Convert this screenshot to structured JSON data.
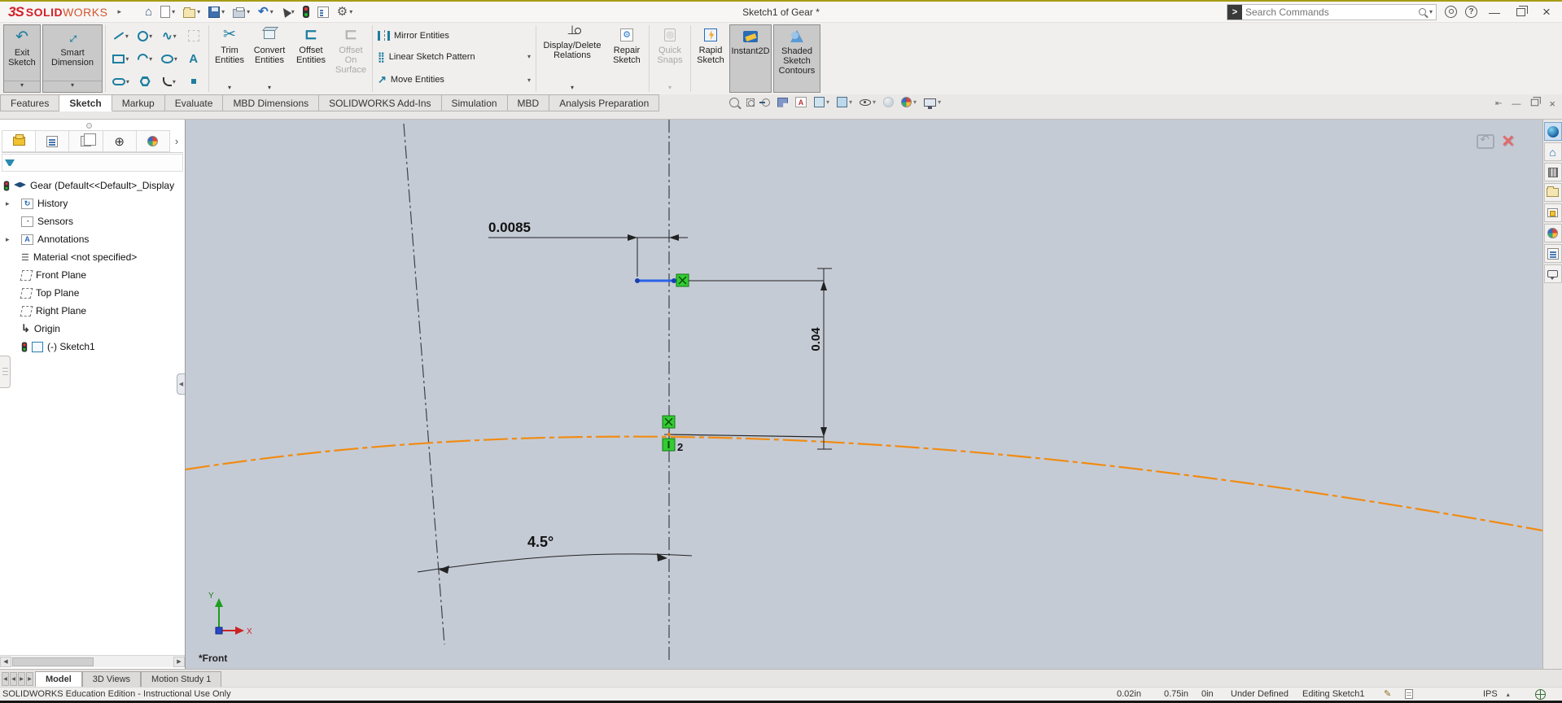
{
  "app": {
    "brand_mark": "3S",
    "brand_bold": "SOLID",
    "brand_light": "WORKS",
    "title": "Sketch1 of Gear *"
  },
  "search_placeholder": "Search Commands",
  "icons": {
    "caret": "▾",
    "caret_up": "▴",
    "expander": "▸",
    "more": "›",
    "home": "⌂",
    "undo": "↶",
    "gear": "⚙",
    "help": "?",
    "minimize": "—",
    "close": "×",
    "left": "◀",
    "right": "▶",
    "history": "↻",
    "gauge": "◔",
    "letter_a": "A",
    "material": "☰",
    "origin": "↳",
    "dimxpert": "⊕",
    "scissors": "✂",
    "offset": "⊏",
    "arrow_ne": "↗",
    "relation": "⊥",
    "pattern": "⣿",
    "snaps": "◎",
    "spline": "∿",
    "pencil": "✎",
    "search_mark": ">"
  },
  "ribbon": {
    "exit_sketch": "Exit Sketch",
    "smart_dimension": "Smart Dimension",
    "trim": "Trim Entities",
    "convert": "Convert Entities",
    "offset": "Offset Entities",
    "offset_on_surface": "Offset On Surface",
    "mirror": "Mirror Entities",
    "linear_pattern": "Linear Sketch Pattern",
    "move": "Move Entities",
    "display_delete": "Display/Delete Relations",
    "repair": "Repair Sketch",
    "quick_snaps": "Quick Snaps",
    "rapid": "Rapid Sketch",
    "instant2d": "Instant2D",
    "shaded": "Shaded Sketch Contours"
  },
  "command_tabs": [
    "Features",
    "Sketch",
    "Markup",
    "Evaluate",
    "MBD Dimensions",
    "SOLIDWORKS Add-Ins",
    "Simulation",
    "MBD",
    "Analysis Preparation"
  ],
  "tree": {
    "root": "Gear  (Default<<Default>_Display",
    "items": [
      "History",
      "Sensors",
      "Annotations",
      "Material <not specified>",
      "Front Plane",
      "Top Plane",
      "Right Plane",
      "Origin",
      "(-) Sketch1"
    ]
  },
  "sketch": {
    "dim_horizontal": "0.0085",
    "dim_vertical": "0.04",
    "dim_angle": "4.5°",
    "relation_number": "2",
    "view_label": "*Front",
    "axis_x": "X",
    "axis_y": "Y"
  },
  "doc_tabs": [
    "Model",
    "3D Views",
    "Motion Study 1"
  ],
  "status": {
    "message": "SOLIDWORKS Education Edition - Instructional Use Only",
    "x": "0.02in",
    "y": "0.75in",
    "z": "0in",
    "state": "Under Defined",
    "mode": "Editing Sketch1",
    "units": "IPS"
  },
  "colors": {
    "accent_top": "#a79b15",
    "viewport_bg": "#c5cbd5",
    "selection_blue": "#2b63e8",
    "relation_green": "#33cc33",
    "curve_orange": "#f18b12",
    "brand_red": "#d22027"
  }
}
